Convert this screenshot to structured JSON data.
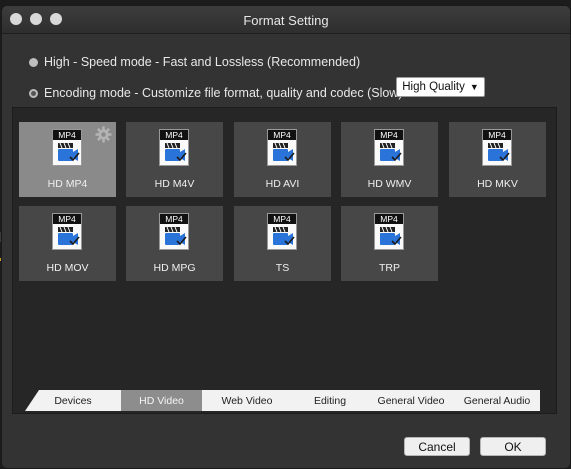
{
  "window": {
    "title": "Format Setting"
  },
  "modes": {
    "high_speed": "High - Speed mode - Fast and Lossless (Recommended)",
    "encoding": "Encoding mode - Customize file format, quality and codec (Slow)"
  },
  "quality_select": {
    "value": "High Quality"
  },
  "formats": [
    {
      "label": "HD MP4",
      "icon_text": "MP4"
    },
    {
      "label": "HD M4V",
      "icon_text": "MP4"
    },
    {
      "label": "HD AVI",
      "icon_text": "MP4"
    },
    {
      "label": "HD WMV",
      "icon_text": "MP4"
    },
    {
      "label": "HD MKV",
      "icon_text": "MP4"
    },
    {
      "label": "HD MOV",
      "icon_text": "MP4"
    },
    {
      "label": "HD MPG",
      "icon_text": "MP4"
    },
    {
      "label": "TS",
      "icon_text": "MP4"
    },
    {
      "label": "TRP",
      "icon_text": "MP4"
    }
  ],
  "tabs": [
    {
      "label": "Devices"
    },
    {
      "label": "HD Video"
    },
    {
      "label": "Web Video"
    },
    {
      "label": "Editing"
    },
    {
      "label": "General Video"
    },
    {
      "label": "General Audio"
    }
  ],
  "buttons": {
    "cancel": "Cancel",
    "ok": "OK"
  },
  "colors": {
    "selected_tile": "#8a8a8a",
    "tile": "#474747",
    "active_tab": "#8d8d8d",
    "clapper_blue": "#2a73d9"
  }
}
